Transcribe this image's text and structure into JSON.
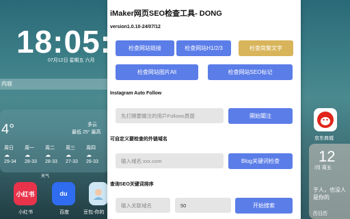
{
  "homescreen": {
    "clock": "18:05:",
    "date": "07月12日 星期五 六月",
    "search_strip": "内容",
    "weather": {
      "temp": "4°",
      "condition": "多云",
      "range": "最低 25° 最高",
      "forecast": [
        {
          "day": "周日",
          "icon": "☁",
          "range": "29-34"
        },
        {
          "day": "周一",
          "icon": "☁",
          "range": "28-33"
        },
        {
          "day": "周二",
          "icon": "☁",
          "range": "28-33"
        },
        {
          "day": "周三",
          "icon": "☁",
          "range": "27-33"
        },
        {
          "day": "周四",
          "icon": "☁",
          "range": "26-33"
        }
      ],
      "app_label": "天气"
    },
    "apps": {
      "xiaohongshu_label": "小红书",
      "xiaohongshu_icon_text": "小红书",
      "baidu_label": "百度",
      "baidu_icon_text": "du",
      "douyin_label": "豆包-你的",
      "jd_label": "京东商城"
    },
    "right_widget": {
      "day": "12",
      "week": "/月 周五",
      "text": "于人，也没人 是你的",
      "label": "历日历"
    }
  },
  "popup": {
    "title": "iMaker网页SEO检查工具- DONG",
    "version": "version1.0.10-24/07/12",
    "buttons": {
      "check_links": "检查网站链接",
      "check_headings": "检查网站H1/2/3",
      "check_simplified": "检查简繁文字",
      "check_image_alt": "检查网站图片Alt",
      "check_seo_tags": "检查网站SEO标记"
    },
    "instagram": {
      "section_label": "Instagram Auto Follow",
      "input_placeholder": "先打開要關注的用戶Follows頁面",
      "start_button": "開始關注"
    },
    "external_links": {
      "section_label": "可自定义要检查的外链域名",
      "input_placeholder": "输入域名:xxx.com",
      "check_button": "Blog关键词检查"
    },
    "keyword_rank": {
      "section_label": "查询SEO关键词排序",
      "domain_placeholder": "输入关联域名",
      "count_value": "50",
      "search_button": "开始搜索"
    },
    "colors": {
      "primary_button": "#5b7de8",
      "gold_button": "#d8b45a",
      "input_bg": "#e5e5e5"
    }
  }
}
